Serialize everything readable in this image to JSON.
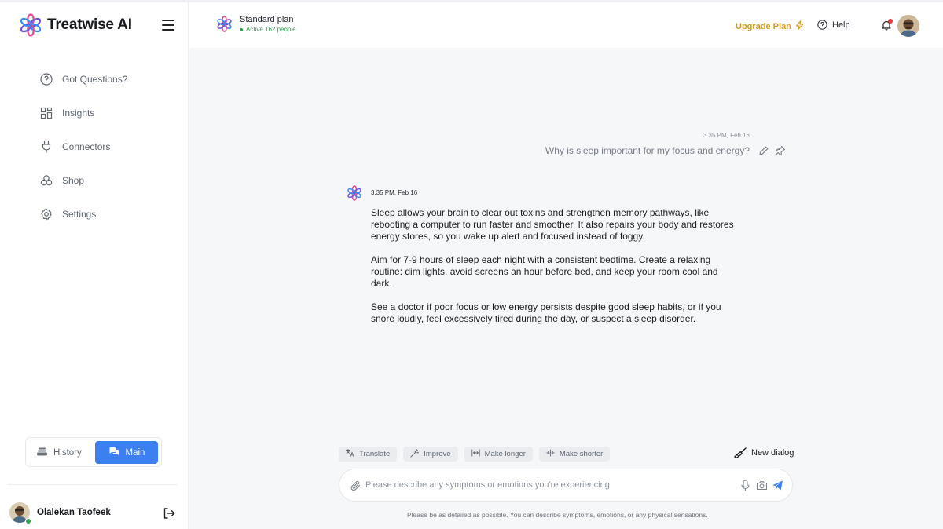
{
  "brand": {
    "name": "Treatwise AI"
  },
  "sidebar": {
    "items": [
      {
        "label": "Got Questions?",
        "icon": "question-circle-icon"
      },
      {
        "label": "Insights",
        "icon": "grid-icon"
      },
      {
        "label": "Connectors",
        "icon": "plug-icon"
      },
      {
        "label": "Shop",
        "icon": "shop-icon"
      },
      {
        "label": "Settings",
        "icon": "gear-icon"
      }
    ],
    "switcher": {
      "history_label": "History",
      "main_label": "Main",
      "active": "Main"
    },
    "user": {
      "name": "Olalekan Taofeek",
      "status": "online"
    }
  },
  "header": {
    "plan_name": "Standard plan",
    "plan_status": "Active 162 people",
    "upgrade_label": "Upgrade Plan",
    "help_label": "Help"
  },
  "chat": {
    "user_message": {
      "time": "3.35 PM, Feb 16",
      "text": "Why is sleep important for my focus and energy?"
    },
    "ai_message": {
      "time": "3.35 PM, Feb 16",
      "paragraphs": [
        "Sleep allows your brain to clear out toxins and strengthen memory pathways, like\nrebooting a computer to run faster and smoother. It also repairs your body and restores\nenergy stores, so you wake up alert and focused instead of foggy.",
        "Aim for 7-9 hours of sleep each night with a consistent bedtime. Create a relaxing\nroutine: dim lights, avoid screens an hour before bed, and keep your room cool and dark.",
        "See a doctor if poor focus or low energy persists despite good sleep habits, or if you\nsnore loudly, feel excessively tired during the day, or suspect a sleep disorder."
      ]
    }
  },
  "composer": {
    "chips": [
      "Translate",
      "Improve",
      "Make longer",
      "Make shorter"
    ],
    "new_dialog_label": "New dialog",
    "placeholder": "Please describe any symptoms or emotions you're experiencing",
    "value": "",
    "hint": "Please be as detailed as possible. You can describe symptoms, emotions, or any physical sensations."
  },
  "colors": {
    "accent": "#3b7ff0",
    "upgrade": "#d79a1a",
    "online": "#2ea44f",
    "notification": "#e23b3b"
  }
}
